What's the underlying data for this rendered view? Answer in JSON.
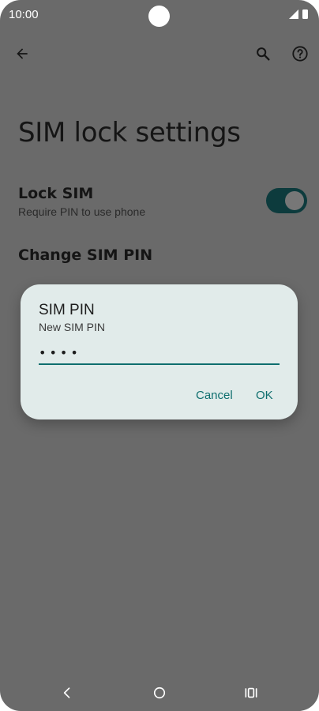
{
  "status_bar": {
    "time": "10:00"
  },
  "app_bar": {
    "back_icon": "arrow-back-icon",
    "search_icon": "search-icon",
    "help_icon": "help-icon"
  },
  "page": {
    "title": "SIM lock settings",
    "lock_sim": {
      "title": "Lock SIM",
      "subtitle": "Require PIN to use phone",
      "enabled": true
    },
    "change_pin": {
      "title": "Change SIM PIN"
    }
  },
  "dialog": {
    "title": "SIM PIN",
    "label": "New SIM PIN",
    "value": "••••",
    "cancel_label": "Cancel",
    "ok_label": "OK"
  },
  "nav_bar": {
    "back_icon": "nav-back-icon",
    "home_icon": "nav-home-icon",
    "recents_icon": "nav-recents-icon"
  },
  "colors": {
    "scrim_background": "#6a6a6a",
    "dialog_background": "#e1ebea",
    "accent": "#0e6e6e",
    "toggle_track": "#0d3b3d"
  }
}
